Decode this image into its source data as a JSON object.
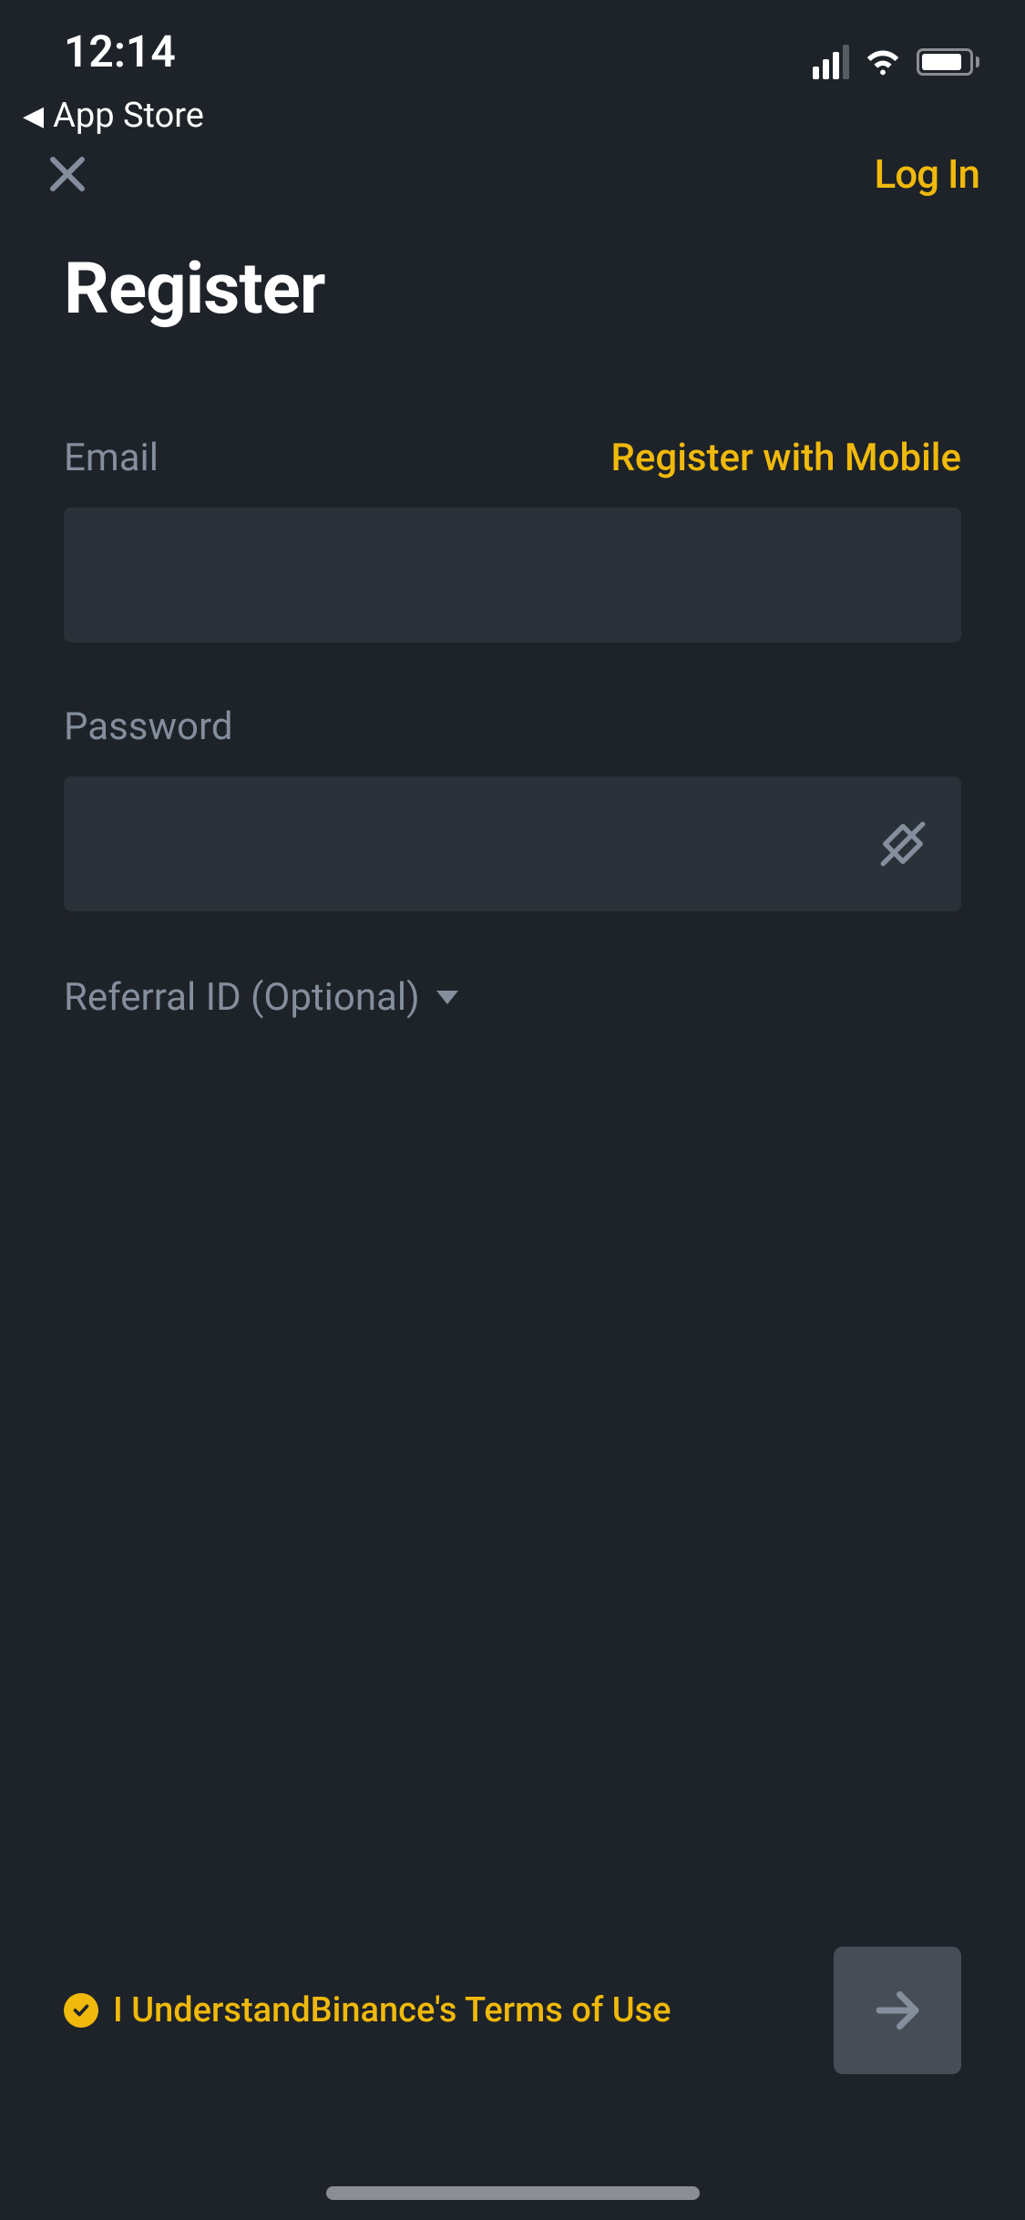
{
  "statusBar": {
    "time": "12:14",
    "backLabel": "App Store"
  },
  "nav": {
    "loginLabel": "Log In"
  },
  "page": {
    "title": "Register"
  },
  "form": {
    "emailLabel": "Email",
    "mobileLinkLabel": "Register with Mobile",
    "passwordLabel": "Password",
    "referralLabel": "Referral ID (Optional)",
    "emailValue": "",
    "passwordValue": ""
  },
  "footer": {
    "termsText": "I UnderstandBinance's Terms of Use"
  },
  "colors": {
    "background": "#1e2329",
    "inputBackground": "#2b3139",
    "accent": "#f0b90b",
    "muted": "#848e9c",
    "buttonDisabled": "#474d57"
  }
}
